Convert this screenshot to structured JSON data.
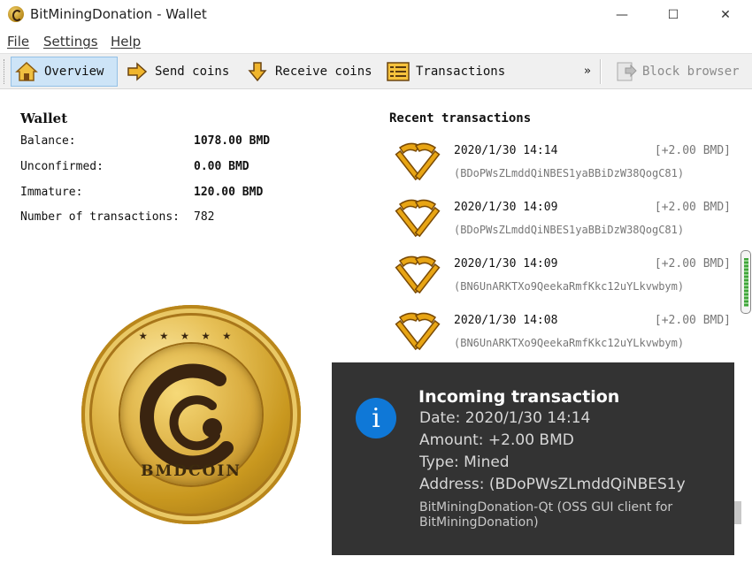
{
  "window": {
    "title": "BitMiningDonation - Wallet",
    "minimize_glyph": "—",
    "maximize_glyph": "☐",
    "close_glyph": "✕"
  },
  "menu": [
    "File",
    "Settings",
    "Help"
  ],
  "toolbar": {
    "overview": "Overview",
    "send": "Send coins",
    "receive": "Receive coins",
    "transactions": "Transactions",
    "more": "»",
    "block_browser": "Block browser"
  },
  "wallet": {
    "title": "Wallet",
    "balance_label": "Balance:",
    "balance_value": "1078.00 BMD",
    "unconfirmed_label": "Unconfirmed:",
    "unconfirmed_value": "0.00 BMD",
    "immature_label": "Immature:",
    "immature_value": "120.00 BMD",
    "ntx_label": "Number of transactions:",
    "ntx_value": "782"
  },
  "coin": {
    "text": "BMDCOIN",
    "stars": "★★★★★"
  },
  "recent": {
    "title": "Recent transactions",
    "items": [
      {
        "date": "2020/1/30 14:14",
        "amount": "[+2.00 BMD]",
        "address": "(BDoPWsZLmddQiNBES1yaBBiDzW38QogC81)"
      },
      {
        "date": "2020/1/30 14:09",
        "amount": "[+2.00 BMD]",
        "address": "(BDoPWsZLmddQiNBES1yaBBiDzW38QogC81)"
      },
      {
        "date": "2020/1/30 14:09",
        "amount": "[+2.00 BMD]",
        "address": "(BN6UnARKTXo9QeekaRmfKkc12uYLkvwbym)"
      },
      {
        "date": "2020/1/30 14:08",
        "amount": "[+2.00 BMD]",
        "address": "(BN6UnARKTXo9QeekaRmfKkc12uYLkvwbym)"
      }
    ]
  },
  "toast": {
    "icon_glyph": "i",
    "title": "Incoming transaction",
    "date": "Date: 2020/1/30 14:14",
    "amount": "Amount: +2.00 BMD",
    "type": "Type: Mined",
    "address": "Address: (BDoPWsZLmddQiNBES1y",
    "source": "BitMiningDonation-Qt (OSS GUI client for BitMiningDonation)"
  },
  "colors": {
    "toolbar_active": "#cde4f7",
    "toast_bg": "#333333",
    "toast_icon": "#0f78d7",
    "hammer": "#e8a514"
  }
}
